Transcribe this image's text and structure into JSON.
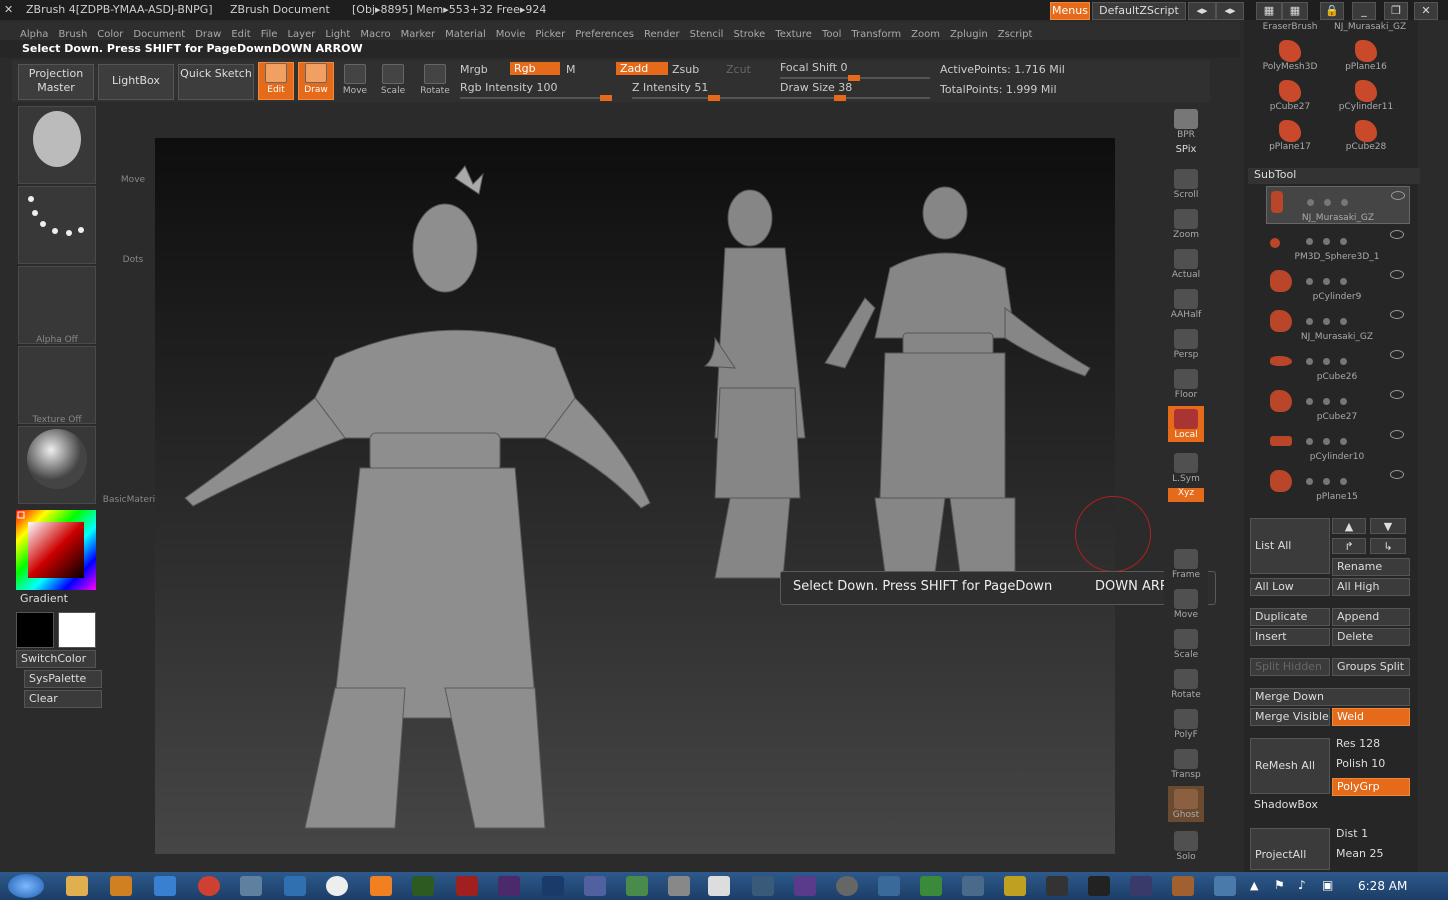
{
  "titlebar": {
    "app": "ZBrush 4[ZDPB-YMAA-ASDJ-BNPG]",
    "doc": "ZBrush Document",
    "stats": "[Obj▸8895] Mem▸553+32 Free▸924",
    "menus_btn": "Menus",
    "script_btn": "DefaultZScript"
  },
  "menubar": [
    "Alpha",
    "Brush",
    "Color",
    "Document",
    "Draw",
    "Edit",
    "File",
    "Layer",
    "Light",
    "Macro",
    "Marker",
    "Material",
    "Movie",
    "Picker",
    "Preferences",
    "Render",
    "Stencil",
    "Stroke",
    "Texture",
    "Tool",
    "Transform",
    "Zoom",
    "Zplugin",
    "Zscript"
  ],
  "note": {
    "text": "Select Down. Press SHIFT for PageDown",
    "key": "DOWN ARROW"
  },
  "toolbar": {
    "projection": "Projection Master",
    "lightbox": "LightBox",
    "quicksketch": "Quick Sketch",
    "edit": "Edit",
    "draw": "Draw",
    "move": "Move",
    "scale": "Scale",
    "rotate": "Rotate",
    "mrgb": "Mrgb",
    "rgb": "Rgb",
    "m": "M",
    "zadd": "Zadd",
    "zsub": "Zsub",
    "zcut": "Zcut",
    "rgb_intensity": "Rgb Intensity 100",
    "z_intensity": "Z Intensity 51",
    "focal_shift": "Focal Shift 0",
    "draw_size": "Draw Size 38",
    "active_points": "ActivePoints: 1.716 Mil",
    "total_points": "TotalPoints: 1.999 Mil"
  },
  "leftshelf": {
    "brush": "Move",
    "stroke": "Dots",
    "alpha": "Alpha  Off",
    "texture": "Texture  Off",
    "material": "BasicMaterial",
    "gradient": "Gradient",
    "switchcolor": "SwitchColor",
    "syspalette": "SysPalette",
    "clear": "Clear"
  },
  "rightshelf": [
    "BPR",
    "SPix",
    "Scroll",
    "Zoom",
    "Actual",
    "AAHalf",
    "Persp",
    "Floor",
    "Local",
    "L.Sym",
    "Xyz",
    "Frame",
    "Move",
    "Scale",
    "Rotate",
    "PolyF",
    "Transp",
    "Ghost",
    "Solo"
  ],
  "panel": {
    "tools": [
      "EraserBrush",
      "NJ_Murasaki_GZ",
      "PolyMesh3D",
      "pPlane16",
      "pCube27",
      "pCylinder11",
      "pPlane17",
      "pCube28"
    ],
    "subtool_title": "SubTool",
    "subtools": [
      "NJ_Murasaki_GZ",
      "PM3D_Sphere3D_1",
      "pCylinder9",
      "NJ_Murasaki_GZ",
      "pCube26",
      "pCube27",
      "pCylinder10",
      "pPlane15"
    ],
    "list_all": "List All",
    "rename": "Rename",
    "all_low": "All Low",
    "all_high": "All High",
    "duplicate": "Duplicate",
    "append": "Append",
    "insert": "Insert",
    "delete": "Delete",
    "split_hidden": "Split Hidden",
    "groups_split": "Groups Split",
    "merge_down": "Merge Down",
    "merge_visible": "Merge Visible",
    "weld": "Weld",
    "remesh_all": "ReMesh All",
    "res": "Res 128",
    "polish": "Polish 10",
    "polygrp": "PolyGrp",
    "shadowbox": "ShadowBox",
    "projectall": "ProjectAll",
    "dist": "Dist 1",
    "mean": "Mean 25"
  },
  "tooltip": {
    "text": "Select Down. Press SHIFT for PageDown",
    "key": "DOWN ARROW"
  },
  "taskbar": {
    "time": "6:28 AM"
  },
  "colors": {
    "accent": "#e56a1a",
    "bg": "#2b2b2b"
  }
}
